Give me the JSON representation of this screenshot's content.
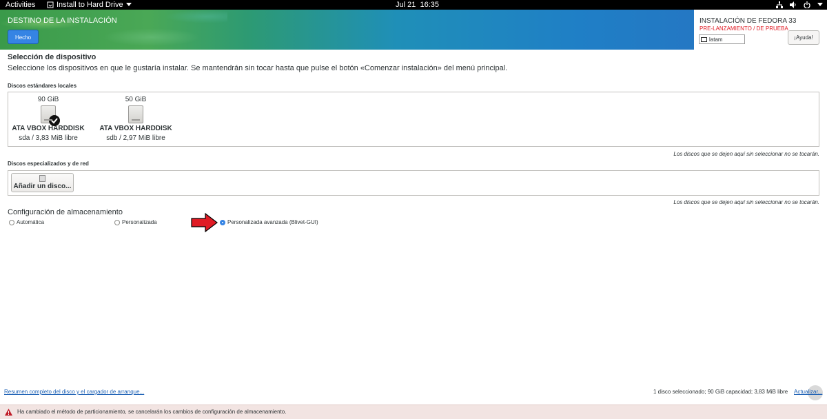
{
  "topbar": {
    "activities": "Activities",
    "app_menu": "Install to Hard Drive",
    "date": "Jul 21",
    "time": "16:35"
  },
  "header": {
    "title": "DESTINO DE LA INSTALACIÓN",
    "done_label": "Hecho",
    "install_title": "INSTALACIÓN DE FEDORA 33",
    "prerelease": "PRE-LANZAMIENTO / DE PRUEBA",
    "keyboard_layout": "latam",
    "help_label": "¡Ayuda!"
  },
  "device_selection": {
    "heading": "Selección de dispositivo",
    "description": "Seleccione los dispositivos en que le gustaría instalar. Se mantendrán sin tocar hasta que pulse el botón «Comenzar instalación» del menú principal."
  },
  "local_disks": {
    "heading": "Discos estándares locales",
    "disks": [
      {
        "size": "90 GiB",
        "name": "ATA VBOX HARDDISK",
        "free": "sda  /  3,83 MiB libre",
        "selected": true
      },
      {
        "size": "50 GiB",
        "name": "ATA VBOX HARDDISK",
        "free": "sdb  /  2,97 MiB libre",
        "selected": false
      }
    ],
    "note": "Los discos que se dejen aquí sin seleccionar no se tocarán."
  },
  "special_disks": {
    "heading": "Discos especializados y de red",
    "add_label": "Añadir un disco...",
    "note": "Los discos que se dejen aquí sin seleccionar no se tocarán."
  },
  "storage_config": {
    "heading": "Configuración de almacenamiento",
    "options": [
      {
        "label": "Automática",
        "checked": false
      },
      {
        "label": "Personalizada",
        "checked": false
      },
      {
        "label": "Personalizada avanzada (Blivet-GUI)",
        "checked": true
      }
    ]
  },
  "footer": {
    "summary_link": "Resumen completo del disco y el cargador de arranque...",
    "summary": "1 disco seleccionado; 90 GiB capacidad; 3,83 MiB libre",
    "refresh": "Actualizar..."
  },
  "warning": {
    "text": "Ha cambiado el método de particionamiento, se cancelarán los cambios de configuración de almacenamiento."
  },
  "colors": {
    "accent": "#3584e4",
    "warning_bg": "#f2e4e2",
    "arrow": "#e01b24",
    "prerelease": "#e01b24"
  }
}
